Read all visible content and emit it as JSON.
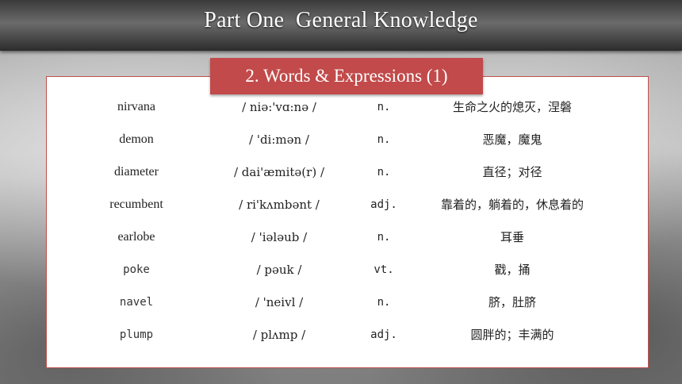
{
  "header": {
    "title": "Part One  General Knowledge"
  },
  "section": {
    "title": "2. Words & Expressions (1)"
  },
  "vocabulary": [
    {
      "word": "nirvana",
      "ipa": "/  niə:'vɑ:nə  /",
      "pos": "n.",
      "definition": "生命之火的熄灭，涅磐"
    },
    {
      "word": "demon",
      "ipa": "/  'di:mən  /",
      "pos": "n.",
      "definition": "恶魔，魔鬼"
    },
    {
      "word": "diameter",
      "ipa": "/  dai'æmitə(r)  /",
      "pos": "n.",
      "definition": "直径；对径"
    },
    {
      "word": "recumbent",
      "ipa": "/  ri'kʌmbənt  /",
      "pos": "adj.",
      "definition": "靠着的，躺着的，休息着的"
    },
    {
      "word": "earlobe",
      "ipa": "/  'iələub  /",
      "pos": "n.",
      "definition": "耳垂"
    },
    {
      "word": "poke",
      "ipa": "/  pəuk  /",
      "pos": "vt.",
      "definition": "戳，捅"
    },
    {
      "word": "navel",
      "ipa": "/  'neivl  /",
      "pos": "n.",
      "definition": "脐，肚脐"
    },
    {
      "word": "plump",
      "ipa": "/  plʌmp  /",
      "pos": "adj.",
      "definition": "圆胖的；丰满的"
    }
  ],
  "colors": {
    "accent": "#c24a4a",
    "panel_border": "#c0504d",
    "header_bg": "#4a4a4a"
  }
}
